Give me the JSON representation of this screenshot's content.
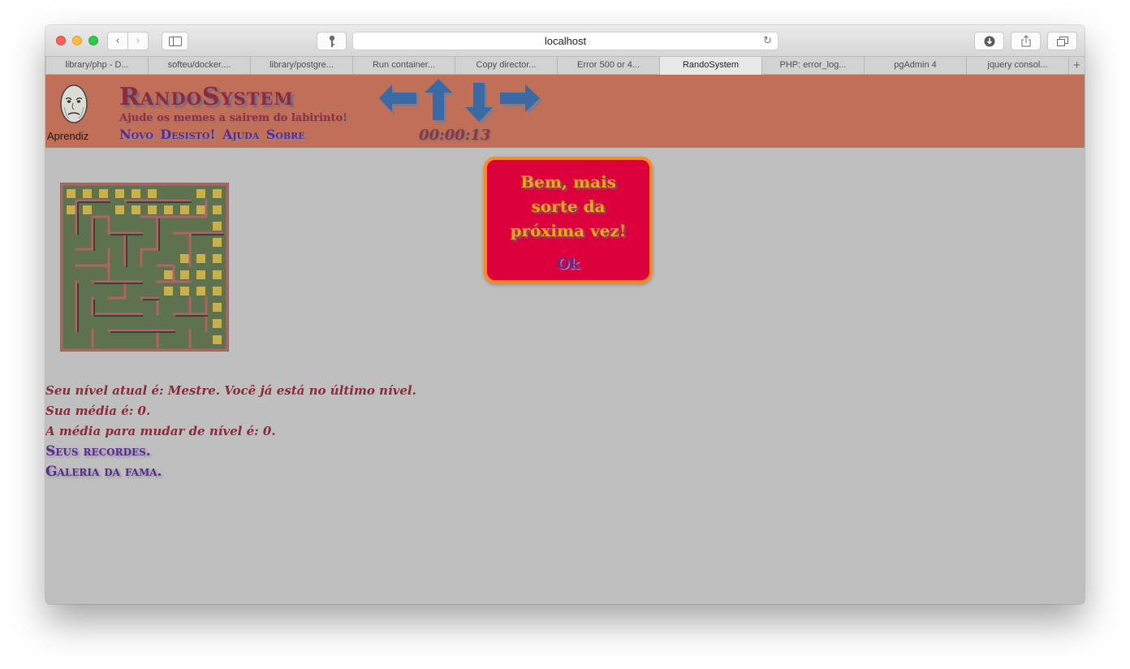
{
  "browser": {
    "url": "localhost",
    "tabs": [
      {
        "label": "library/php - D..."
      },
      {
        "label": "softeu/docker...."
      },
      {
        "label": "library/postgre..."
      },
      {
        "label": "Run container..."
      },
      {
        "label": "Copy director..."
      },
      {
        "label": "Error 500 or 4..."
      },
      {
        "label": "RandoSystem",
        "active": true
      },
      {
        "label": "PHP: error_log..."
      },
      {
        "label": "pgAdmin 4"
      },
      {
        "label": "jquery consol..."
      }
    ],
    "icons": {
      "back": "chevron-left-icon",
      "forward": "chevron-right-icon",
      "sidebar": "sidebar-icon",
      "key": "key-icon",
      "reload": "reload-icon",
      "download": "download-icon",
      "share": "share-icon",
      "tabs": "tabs-overview-icon",
      "new_tab": "plus-icon"
    },
    "glyphs": {
      "back": "‹",
      "forward": "›",
      "reload": "↻",
      "add": "+"
    }
  },
  "header": {
    "user_label": "Aprendiz",
    "title": "RandoSystem",
    "subtitle": "Ajude os memes a sairem do labirinto!",
    "links": [
      {
        "label": "Novo"
      },
      {
        "label": "Desisto!"
      },
      {
        "label": "Ajuda"
      },
      {
        "label": "Sobre"
      }
    ],
    "timer": "00:00:13",
    "arrows": [
      "arrow-left-icon",
      "arrow-up-icon",
      "arrow-down-icon",
      "arrow-right-icon"
    ],
    "colors": {
      "header_bg": "#c07058",
      "arrow": "#3a6aa6",
      "title": "#8c2a3e"
    }
  },
  "dialog": {
    "message": "Bem, mais sorte da próxima vez!",
    "ok_label": "Ok",
    "colors": {
      "bg": "#dc003c",
      "border": "#ff8a1c",
      "text": "#ff9f1a"
    }
  },
  "info": {
    "level_text": "Seu nível atual é: Mestre. Você já está no último nível.",
    "average_text": "Sua média é: 0.",
    "next_level_text": "A média para mudar de nível é: 0.",
    "records_link": "Seus recordes.",
    "fame_link": "Galeria da fama."
  },
  "maze": {
    "colors": {
      "floor": "#5e7250",
      "wall": "#b06464",
      "path": "#c9b04a"
    }
  }
}
